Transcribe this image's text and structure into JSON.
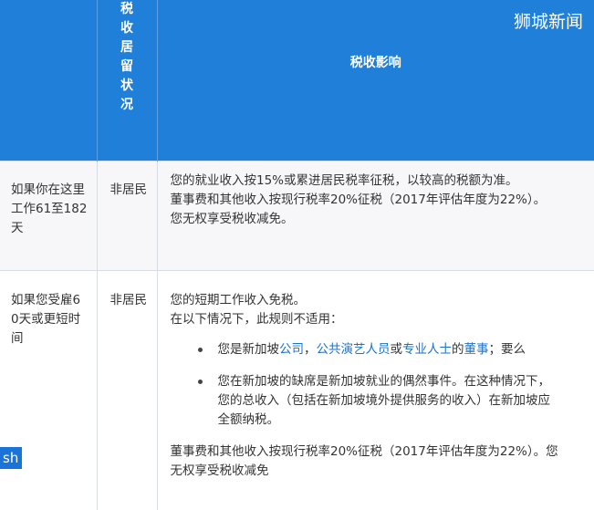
{
  "header": {
    "col1": "",
    "col2": "税收居留状况",
    "col3": "税收影响"
  },
  "watermark": "狮城新闻",
  "corner_badge": "sh",
  "rows": [
    {
      "situation": "如果你在这里工作61至182天",
      "status": "非居民",
      "impact_lines": [
        "您的就业收入按15%或累进居民税率征税，以较高的税额为准。",
        "董事费和其他收入按现行税率20%征税（2017年评估年度为22%）。",
        "您无权享受税收减免。"
      ]
    },
    {
      "situation": "如果您受雇60天或更短时间",
      "status": "非居民",
      "impact_lines": [
        "您的短期工作收入免税。",
        "在以下情况下，此规则不适用："
      ],
      "bullet1": {
        "p1": "您是新加坡",
        "link1": "公司",
        "p2": "，",
        "link2": "公共演艺人员",
        "p3": "或",
        "link3": "专业人士",
        "p4": "的",
        "link4": "董事",
        "p5": "；要么"
      },
      "bullet2_lines": [
        "您在新加坡的缺席是新加坡就业的偶然事件。在这种情况下，",
        "您的总收入（包括在新加坡境外提供服务的收入）在新加坡应",
        "全额纳税。"
      ],
      "footer_lines": [
        "董事费和其他收入按现行税率20%征税（2017年评估年度为22%）。您",
        "无权享受税收减免"
      ]
    }
  ]
}
